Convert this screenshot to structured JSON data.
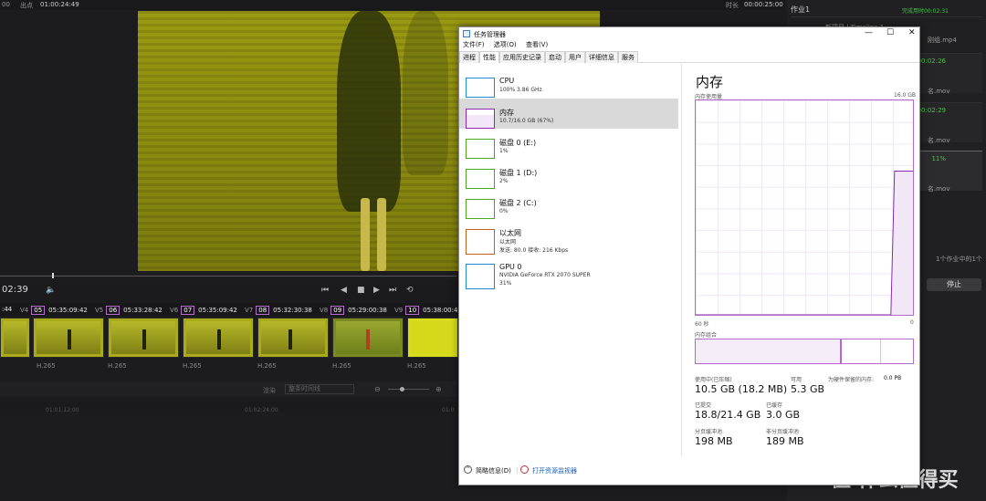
{
  "resolve": {
    "top_left_label": "00",
    "out_label": "出点",
    "out_time": "01:00:24:49",
    "duration_label": "时长",
    "duration_value": "00:00:25:00",
    "current_time": "02:39",
    "clips": [
      {
        "tc_prefix": ":44",
        "track": "V4",
        "num": "05",
        "tc": "05:35:09:42",
        "codec": "H.265"
      },
      {
        "track": "V5",
        "num": "06",
        "tc": "05:33:28:42",
        "codec": "H.265"
      },
      {
        "track": "V6",
        "num": "07",
        "tc": "05:35:09:42",
        "codec": "H.265"
      },
      {
        "track": "V7",
        "num": "08",
        "tc": "05:32:30:38",
        "codec": "H.265"
      },
      {
        "track": "V8",
        "num": "09",
        "tc": "05:29:00:38",
        "codec": "H.265"
      },
      {
        "track": "V9",
        "num": "10",
        "tc": "05:38:00:4",
        "codec": "H.265"
      }
    ],
    "render_label": "渲染",
    "render_select": "整条时间线",
    "ruler_marks": [
      "01:01:12:00",
      "01:02:24:00",
      "01:0"
    ],
    "right_panel": {
      "job_title": "作业1",
      "job_status": "完成用时00:02:31",
      "rows": [
        {
          "name": "新项目 | Timeline 1",
          "file": "刚组.mp4",
          "status": "00:02:31"
        },
        {
          "file": "名.mov",
          "status": "00:02:26"
        },
        {
          "file": "名.mov",
          "status": "00:02:29"
        },
        {
          "file": "名.mov",
          "status": "11%"
        }
      ],
      "queue_text": "1个作业中的1个",
      "stop_label": "停止"
    },
    "watermark": "值 什么值得买"
  },
  "taskmanager": {
    "title": "任务管理器",
    "window_buttons": [
      "—",
      "☐",
      "✕"
    ],
    "menu": [
      "文件(F)",
      "选项(O)",
      "查看(V)"
    ],
    "tabs": [
      "进程",
      "性能",
      "应用历史记录",
      "启动",
      "用户",
      "详细信息",
      "服务"
    ],
    "active_tab": "性能",
    "items": [
      {
        "name": "CPU",
        "sub": "100% 3.86 GHz",
        "sub2": "",
        "color": "#1f8ad2"
      },
      {
        "name": "内存",
        "sub": "10.7/16.0 GB (67%)",
        "sub2": "",
        "color": "#8b29b0"
      },
      {
        "name": "磁盘 0 (E:)",
        "sub": "1%",
        "sub2": "",
        "color": "#4da520"
      },
      {
        "name": "磁盘 1 (D:)",
        "sub": "2%",
        "sub2": "",
        "color": "#4da520"
      },
      {
        "name": "磁盘 2 (C:)",
        "sub": "0%",
        "sub2": "",
        "color": "#4da520"
      },
      {
        "name": "以太网",
        "sub": "以太网",
        "sub2": "发送: 80.0 接收: 216 Kbps",
        "color": "#c0621c"
      },
      {
        "name": "GPU 0",
        "sub": "NVIDIA GeForce RTX 2070 SUPER",
        "sub2": "31%",
        "color": "#1f8ad2"
      }
    ],
    "detail": {
      "title": "内存",
      "usage_label": "内存使用量",
      "max_label": "16.0 GB",
      "axis_left": "60 秒",
      "axis_right": "0",
      "composition_label": "内存组合",
      "in_use_label": "使用中(已压缩)",
      "in_use_value": "10.5 GB (18.2 MB)",
      "available_label": "可用",
      "available_value": "5.3 GB",
      "reserved_label": "为硬件保留的内存:",
      "reserved_value": "0.0 PB",
      "committed_label": "已提交",
      "committed_value": "18.8/21.4 GB",
      "cached_label": "已缓存",
      "cached_value": "3.0 GB",
      "paged_label": "分页缓冲池",
      "paged_value": "198 MB",
      "nonpaged_label": "非分页缓冲池",
      "nonpaged_value": "189 MB",
      "usage_history": [
        0,
        0,
        0,
        0,
        0,
        0,
        0,
        0,
        0,
        0,
        0,
        0,
        0,
        0,
        0,
        0,
        0,
        0,
        0,
        0,
        0,
        0,
        0,
        0,
        0,
        0,
        0,
        0,
        0,
        0,
        0,
        0,
        0,
        0,
        0,
        0,
        0,
        0,
        0,
        0,
        0,
        0,
        0,
        0,
        0,
        0,
        0,
        0,
        0,
        0,
        0,
        0,
        0,
        0,
        67,
        67,
        67,
        67,
        67,
        67
      ]
    },
    "footer_less": "简略信息(D)",
    "footer_link": "打开资源监视器"
  }
}
